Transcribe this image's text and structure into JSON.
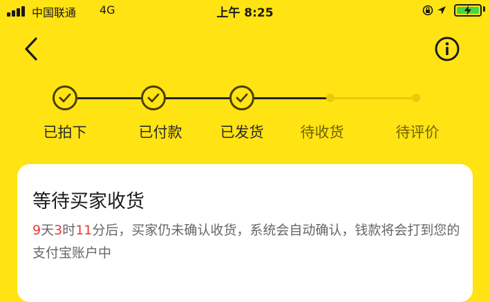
{
  "status_bar": {
    "carrier": "中国联通",
    "network": "4G",
    "time": "上午 8:25",
    "battery_color": "#44D744"
  },
  "nav": {
    "back_icon": "chevron-left-icon",
    "info_icon": "info-circle-icon"
  },
  "steps": [
    {
      "label": "已拍下",
      "done": true
    },
    {
      "label": "已付款",
      "done": true
    },
    {
      "label": "已发货",
      "done": true
    },
    {
      "label": "待收货",
      "done": false
    },
    {
      "label": "待评价",
      "done": false
    }
  ],
  "card": {
    "title": "等待买家收货",
    "countdown": {
      "days": "9",
      "days_unit": "天",
      "hours": "3",
      "hours_unit": "时",
      "minutes": "11",
      "minutes_unit": "分后，",
      "message": "买家仍未确认收货，系统会自动确认，钱款将会打到您的支付宝账户中"
    }
  },
  "colors": {
    "background": "#FFE312",
    "accent_red": "#E53935"
  }
}
